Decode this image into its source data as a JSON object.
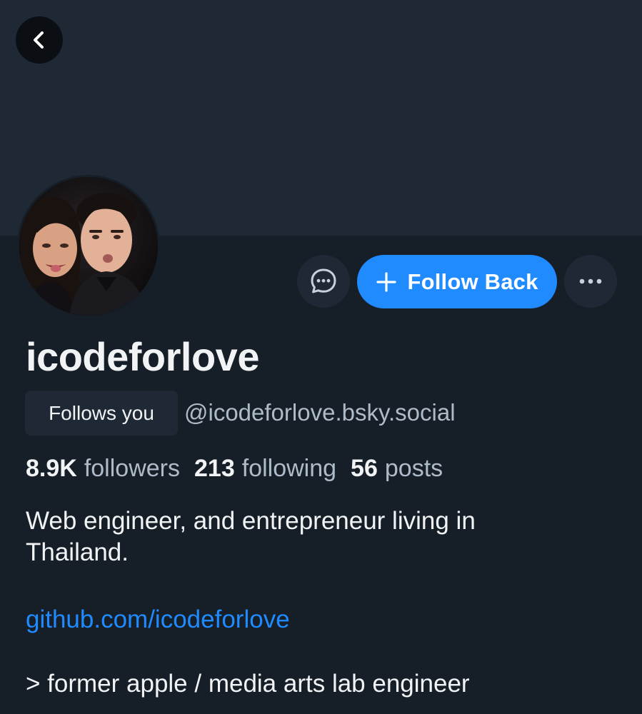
{
  "colors": {
    "background": "#161e27",
    "banner": "#1e2935",
    "accent": "#208bfe",
    "text_primary": "#f1f3f5",
    "text_secondary": "#aebbc9"
  },
  "header": {
    "back_icon": "chevron-left-icon"
  },
  "profile": {
    "avatar_icon": "avatar-photo",
    "display_name": "icodeforlove",
    "follows_you_badge": "Follows you",
    "handle": "@icodeforlove.bsky.social"
  },
  "actions": {
    "message_icon": "message-bubble-icon",
    "follow_icon": "plus-icon",
    "follow_label": "Follow Back",
    "more_icon": "ellipsis-icon"
  },
  "stats": {
    "followers_count": "8.9K",
    "followers_label": "followers",
    "following_count": "213",
    "following_label": "following",
    "posts_count": "56",
    "posts_label": "posts"
  },
  "bio": {
    "line1": "Web engineer, and entrepreneur living in",
    "line2": "Thailand.",
    "link": "github.com/icodeforlove",
    "line3": "> former apple / media arts lab engineer"
  }
}
